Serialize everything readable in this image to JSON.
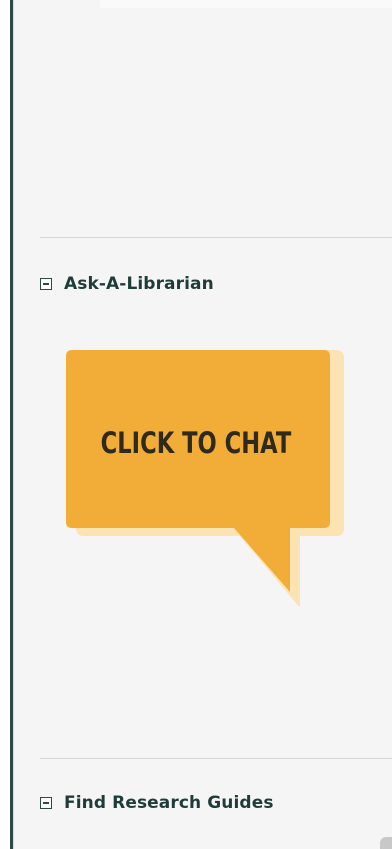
{
  "sidebar": {
    "sections": [
      {
        "title": "Ask-A-Librarian",
        "toggle": "collapse-icon"
      },
      {
        "title": "Find Research Guides",
        "toggle": "collapse-icon"
      }
    ],
    "chat": {
      "label": "CLICK TO CHAT",
      "bubble_color": "#f2ad38",
      "shadow_color": "#fbe3b4"
    }
  },
  "colors": {
    "heading": "#1e3d39",
    "border": "#2f4a45",
    "background": "#f5f5f5"
  }
}
